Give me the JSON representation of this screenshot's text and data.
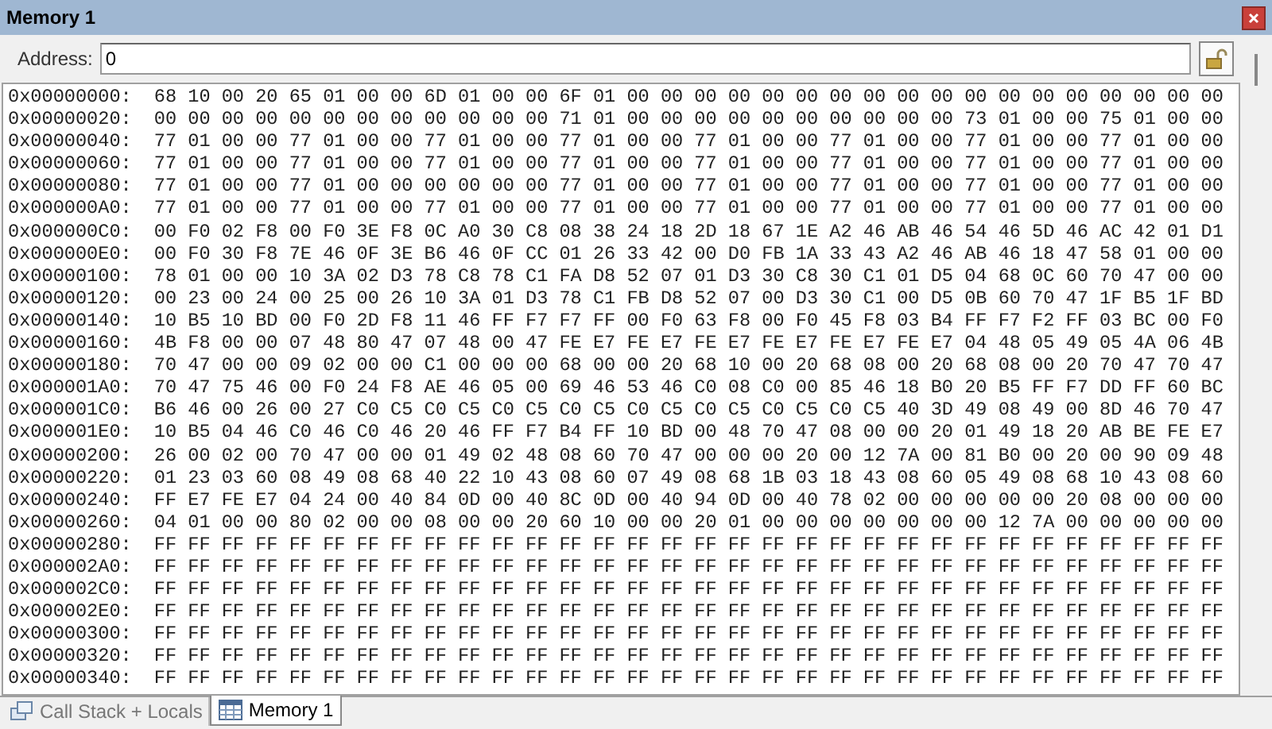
{
  "window": {
    "title": "Memory 1"
  },
  "address": {
    "label": "Address:",
    "value": "0"
  },
  "rows": [
    {
      "address": "0x00000000:",
      "bytes": "68 10 00 20 65 01 00 00 6D 01 00 00 6F 01 00 00 00 00 00 00 00 00 00 00 00 00 00 00 00 00 00 00"
    },
    {
      "address": "0x00000020:",
      "bytes": "00 00 00 00 00 00 00 00 00 00 00 00 71 01 00 00 00 00 00 00 00 00 00 00 73 01 00 00 75 01 00 00"
    },
    {
      "address": "0x00000040:",
      "bytes": "77 01 00 00 77 01 00 00 77 01 00 00 77 01 00 00 77 01 00 00 77 01 00 00 77 01 00 00 77 01 00 00"
    },
    {
      "address": "0x00000060:",
      "bytes": "77 01 00 00 77 01 00 00 77 01 00 00 77 01 00 00 77 01 00 00 77 01 00 00 77 01 00 00 77 01 00 00"
    },
    {
      "address": "0x00000080:",
      "bytes": "77 01 00 00 77 01 00 00 00 00 00 00 77 01 00 00 77 01 00 00 77 01 00 00 77 01 00 00 77 01 00 00"
    },
    {
      "address": "0x000000A0:",
      "bytes": "77 01 00 00 77 01 00 00 77 01 00 00 77 01 00 00 77 01 00 00 77 01 00 00 77 01 00 00 77 01 00 00"
    },
    {
      "address": "0x000000C0:",
      "bytes": "00 F0 02 F8 00 F0 3E F8 0C A0 30 C8 08 38 24 18 2D 18 67 1E A2 46 AB 46 54 46 5D 46 AC 42 01 D1"
    },
    {
      "address": "0x000000E0:",
      "bytes": "00 F0 30 F8 7E 46 0F 3E B6 46 0F CC 01 26 33 42 00 D0 FB 1A 33 43 A2 46 AB 46 18 47 58 01 00 00"
    },
    {
      "address": "0x00000100:",
      "bytes": "78 01 00 00 10 3A 02 D3 78 C8 78 C1 FA D8 52 07 01 D3 30 C8 30 C1 01 D5 04 68 0C 60 70 47 00 00"
    },
    {
      "address": "0x00000120:",
      "bytes": "00 23 00 24 00 25 00 26 10 3A 01 D3 78 C1 FB D8 52 07 00 D3 30 C1 00 D5 0B 60 70 47 1F B5 1F BD"
    },
    {
      "address": "0x00000140:",
      "bytes": "10 B5 10 BD 00 F0 2D F8 11 46 FF F7 F7 FF 00 F0 63 F8 00 F0 45 F8 03 B4 FF F7 F2 FF 03 BC 00 F0"
    },
    {
      "address": "0x00000160:",
      "bytes": "4B F8 00 00 07 48 80 47 07 48 00 47 FE E7 FE E7 FE E7 FE E7 FE E7 FE E7 04 48 05 49 05 4A 06 4B"
    },
    {
      "address": "0x00000180:",
      "bytes": "70 47 00 00 09 02 00 00 C1 00 00 00 68 00 00 20 68 10 00 20 68 08 00 20 68 08 00 20 70 47 70 47"
    },
    {
      "address": "0x000001A0:",
      "bytes": "70 47 75 46 00 F0 24 F8 AE 46 05 00 69 46 53 46 C0 08 C0 00 85 46 18 B0 20 B5 FF F7 DD FF 60 BC"
    },
    {
      "address": "0x000001C0:",
      "bytes": "B6 46 00 26 00 27 C0 C5 C0 C5 C0 C5 C0 C5 C0 C5 C0 C5 C0 C5 C0 C5 40 3D 49 08 49 00 8D 46 70 47"
    },
    {
      "address": "0x000001E0:",
      "bytes": "10 B5 04 46 C0 46 C0 46 20 46 FF F7 B4 FF 10 BD 00 48 70 47 08 00 00 20 01 49 18 20 AB BE FE E7"
    },
    {
      "address": "0x00000200:",
      "bytes": "26 00 02 00 70 47 00 00 01 49 02 48 08 60 70 47 00 00 00 20 00 12 7A 00 81 B0 00 20 00 90 09 48"
    },
    {
      "address": "0x00000220:",
      "bytes": "01 23 03 60 08 49 08 68 40 22 10 43 08 60 07 49 08 68 1B 03 18 43 08 60 05 49 08 68 10 43 08 60"
    },
    {
      "address": "0x00000240:",
      "bytes": "FF E7 FE E7 04 24 00 40 84 0D 00 40 8C 0D 00 40 94 0D 00 40 78 02 00 00 00 00 00 20 08 00 00 00"
    },
    {
      "address": "0x00000260:",
      "bytes": "04 01 00 00 80 02 00 00 08 00 00 20 60 10 00 00 20 01 00 00 00 00 00 00 00 12 7A 00 00 00 00 00"
    },
    {
      "address": "0x00000280:",
      "bytes": "FF FF FF FF FF FF FF FF FF FF FF FF FF FF FF FF FF FF FF FF FF FF FF FF FF FF FF FF FF FF FF FF"
    },
    {
      "address": "0x000002A0:",
      "bytes": "FF FF FF FF FF FF FF FF FF FF FF FF FF FF FF FF FF FF FF FF FF FF FF FF FF FF FF FF FF FF FF FF"
    },
    {
      "address": "0x000002C0:",
      "bytes": "FF FF FF FF FF FF FF FF FF FF FF FF FF FF FF FF FF FF FF FF FF FF FF FF FF FF FF FF FF FF FF FF"
    },
    {
      "address": "0x000002E0:",
      "bytes": "FF FF FF FF FF FF FF FF FF FF FF FF FF FF FF FF FF FF FF FF FF FF FF FF FF FF FF FF FF FF FF FF"
    },
    {
      "address": "0x00000300:",
      "bytes": "FF FF FF FF FF FF FF FF FF FF FF FF FF FF FF FF FF FF FF FF FF FF FF FF FF FF FF FF FF FF FF FF"
    },
    {
      "address": "0x00000320:",
      "bytes": "FF FF FF FF FF FF FF FF FF FF FF FF FF FF FF FF FF FF FF FF FF FF FF FF FF FF FF FF FF FF FF FF"
    },
    {
      "address": "0x00000340:",
      "bytes": "FF FF FF FF FF FF FF FF FF FF FF FF FF FF FF FF FF FF FF FF FF FF FF FF FF FF FF FF FF FF FF FF"
    }
  ],
  "tabs": [
    {
      "label": "Call Stack + Locals",
      "selected": false,
      "kind": "stack"
    },
    {
      "label": "Memory 1",
      "selected": true,
      "kind": "memory"
    }
  ]
}
